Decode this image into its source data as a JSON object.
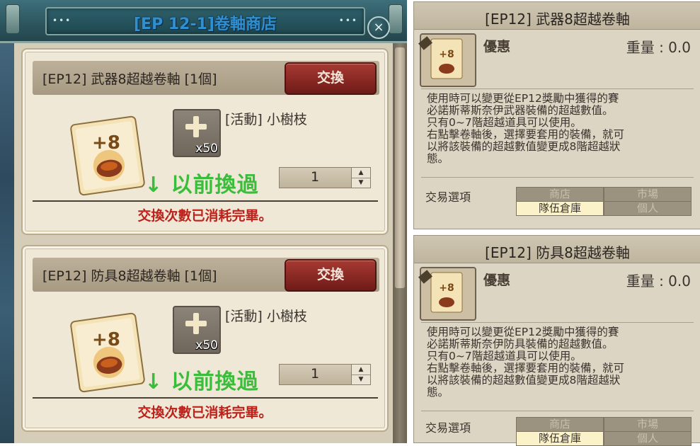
{
  "shop": {
    "title": "[EP 12-1]卷軸商店",
    "close_symbol": "×",
    "items": [
      {
        "name": "[EP12] 武器8超越卷軸 [1個]",
        "exchange_label": "交換",
        "material_name": "[活動] 小樹枝",
        "material_qty": "x50",
        "note": "↓ 以前換過",
        "quantity": "1",
        "status": "交換次數已消耗完畢。",
        "icon_text": "+8"
      },
      {
        "name": "[EP12] 防具8超越卷軸 [1個]",
        "exchange_label": "交換",
        "material_name": "[活動] 小樹枝",
        "material_qty": "x50",
        "note": "↓ 以前換過",
        "quantity": "1",
        "status": "交換次數已消耗完畢。",
        "icon_text": "+8"
      }
    ]
  },
  "tooltips": [
    {
      "title": "[EP12] 武器8超越卷軸",
      "grade": "優惠",
      "weight": "重量 : 0.0",
      "icon_text": "+8",
      "description": [
        "使用時可以變更從EP12獎勵中獲得的賽",
        "必諾斯蒂斯奈伊武器裝備的超越數值。",
        "只有0~7階超越道具可以使用。",
        "右點擊卷軸後，選擇要套用的裝備，就可",
        "以將該裝備的超越數值變更成8階超越狀",
        "態。"
      ],
      "trade_label": "交易選項",
      "trade_options": [
        "商店",
        "市場",
        "隊伍倉庫",
        "個人"
      ],
      "trade_enabled": [
        false,
        false,
        true,
        false
      ]
    },
    {
      "title": "[EP12] 防具8超越卷軸",
      "grade": "優惠",
      "weight": "重量 : 0.0",
      "icon_text": "+8",
      "description": [
        "使用時可以變更從EP12獎勵中獲得的賽",
        "必諾斯蒂斯奈伊防具裝備的超越數值。",
        "只有0~7階超越道具可以使用。",
        "右點擊卷軸後，選擇要套用的裝備，就可",
        "以將該裝備的超越數值變更成8階超越狀",
        "態。"
      ],
      "trade_label": "交易選項",
      "trade_options": [
        "商店",
        "市場",
        "隊伍倉庫",
        "個人"
      ],
      "trade_enabled": [
        false,
        false,
        true,
        false
      ]
    }
  ],
  "colors": {
    "exchange_button": "#8c2a25",
    "note_green": "#3bbd3b",
    "status_red": "#c0201a",
    "title_blue": "#2f8fd0"
  }
}
